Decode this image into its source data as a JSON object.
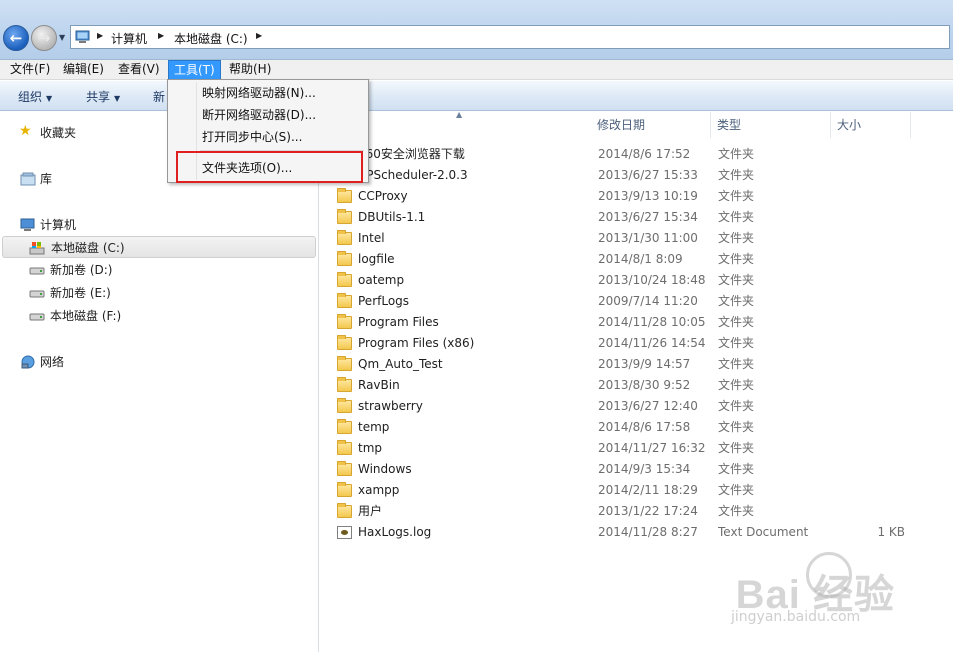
{
  "address": {
    "crumbs": [
      "计算机",
      "本地磁盘 (C:)"
    ]
  },
  "menubar": [
    "文件(F)",
    "编辑(E)",
    "查看(V)",
    "工具(T)",
    "帮助(H)"
  ],
  "commandbar": {
    "organize": "组织",
    "share": "共享",
    "new_truncated": "新"
  },
  "dropdown": {
    "items": [
      "映射网络驱动器(N)...",
      "断开网络驱动器(D)...",
      "打开同步中心(S)...",
      "文件夹选项(O)..."
    ]
  },
  "navpane": {
    "favorites": "收藏夹",
    "libraries": "库",
    "computer": "计算机",
    "drives": [
      "本地磁盘 (C:)",
      "新加卷 (D:)",
      "新加卷 (E:)",
      "本地磁盘 (F:)"
    ],
    "network": "网络"
  },
  "columns": {
    "date": "修改日期",
    "type": "类型",
    "size": "大小"
  },
  "files": [
    {
      "name": "360安全浏览器下载",
      "date": "2014/8/6 17:52",
      "type": "文件夹",
      "size": ""
    },
    {
      "name": "APScheduler-2.0.3",
      "date": "2013/6/27 15:33",
      "type": "文件夹",
      "size": ""
    },
    {
      "name": "CCProxy",
      "date": "2013/9/13 10:19",
      "type": "文件夹",
      "size": ""
    },
    {
      "name": "DBUtils-1.1",
      "date": "2013/6/27 15:34",
      "type": "文件夹",
      "size": ""
    },
    {
      "name": "Intel",
      "date": "2013/1/30 11:00",
      "type": "文件夹",
      "size": ""
    },
    {
      "name": "logfile",
      "date": "2014/8/1 8:09",
      "type": "文件夹",
      "size": ""
    },
    {
      "name": "oatemp",
      "date": "2013/10/24 18:48",
      "type": "文件夹",
      "size": ""
    },
    {
      "name": "PerfLogs",
      "date": "2009/7/14 11:20",
      "type": "文件夹",
      "size": ""
    },
    {
      "name": "Program Files",
      "date": "2014/11/28 10:05",
      "type": "文件夹",
      "size": ""
    },
    {
      "name": "Program Files (x86)",
      "date": "2014/11/26 14:54",
      "type": "文件夹",
      "size": ""
    },
    {
      "name": "Qm_Auto_Test",
      "date": "2013/9/9 14:57",
      "type": "文件夹",
      "size": ""
    },
    {
      "name": "RavBin",
      "date": "2013/8/30 9:52",
      "type": "文件夹",
      "size": ""
    },
    {
      "name": "strawberry",
      "date": "2013/6/27 12:40",
      "type": "文件夹",
      "size": ""
    },
    {
      "name": "temp",
      "date": "2014/8/6 17:58",
      "type": "文件夹",
      "size": ""
    },
    {
      "name": "tmp",
      "date": "2014/11/27 16:32",
      "type": "文件夹",
      "size": ""
    },
    {
      "name": "Windows",
      "date": "2014/9/3 15:34",
      "type": "文件夹",
      "size": ""
    },
    {
      "name": "xampp",
      "date": "2014/2/11 18:29",
      "type": "文件夹",
      "size": ""
    },
    {
      "name": "用户",
      "date": "2013/1/22 17:24",
      "type": "文件夹",
      "size": ""
    },
    {
      "name": "HaxLogs.log",
      "date": "2014/11/28 8:27",
      "type": "Text Document",
      "size": "1 KB"
    }
  ],
  "watermark": {
    "brand": "Bai 经验",
    "url": "jingyan.baidu.com"
  }
}
